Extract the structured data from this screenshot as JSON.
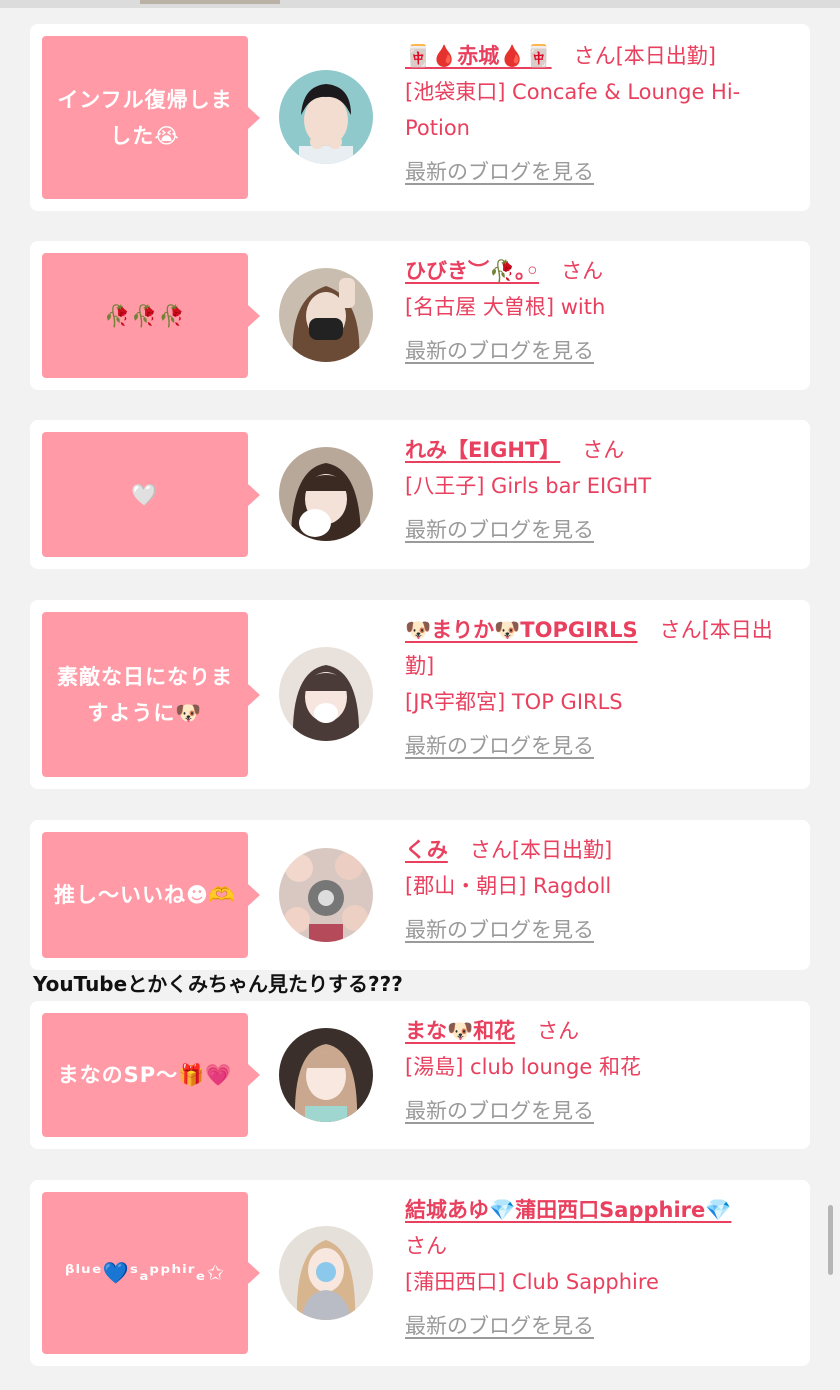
{
  "cards": [
    {
      "bubble": "インフル復帰しました😭",
      "name": "🀄🩸赤城🩸🀄",
      "san": "さん[本日出勤]",
      "shop": "[池袋東口] Concafe & Lounge Hi-Potion",
      "blog": "最新のブログを見る"
    },
    {
      "bubble": "🥀🥀🥀",
      "name": "ひびき︶🥀｡◦",
      "san": "さん",
      "shop": "[名古屋 大曽根] with",
      "blog": "最新のブログを見る"
    },
    {
      "bubble": "🤍",
      "name": "れみ【EIGHT】",
      "san": "さん",
      "shop": "[八王子] Girls bar EIGHT",
      "blog": "最新のブログを見る"
    },
    {
      "bubble": "素敵な日になりますように🐶",
      "name": "🐶まりか🐶TOPGIRLS",
      "san": "さん[本日出勤]",
      "shop": "[JR宇都宮] TOP GIRLS",
      "blog": "最新のブログを見る"
    },
    {
      "bubble": "推し〜いいね☻🫶",
      "name": "くみ",
      "san": "さん[本日出勤]",
      "shop": "[郡山・朝日] Ragdoll",
      "blog": "最新のブログを見る"
    },
    {
      "bubble": "まなのSP〜🎁💗",
      "name": "まな🐶和花",
      "san": "さん",
      "shop": "[湯島] club lounge 和花",
      "blog": "最新のブログを見る"
    },
    {
      "bubble": "ᵝˡᵘᵉ💙ˢₐᵖᵖʰⁱʳₑ✩",
      "name": "結城あゆ💎蒲田西口Sapphire💎",
      "san": "さん",
      "shop": "[蒲田西口] Club Sapphire",
      "blog": "最新のブログを見る"
    }
  ],
  "comment": "YouTubeとかくみちゃん見たりする???",
  "colors": {
    "accent": "#e8405e",
    "bubble": "#ff9aa6",
    "link_gray": "#9a9a9a",
    "background": "#f2f2f2"
  }
}
